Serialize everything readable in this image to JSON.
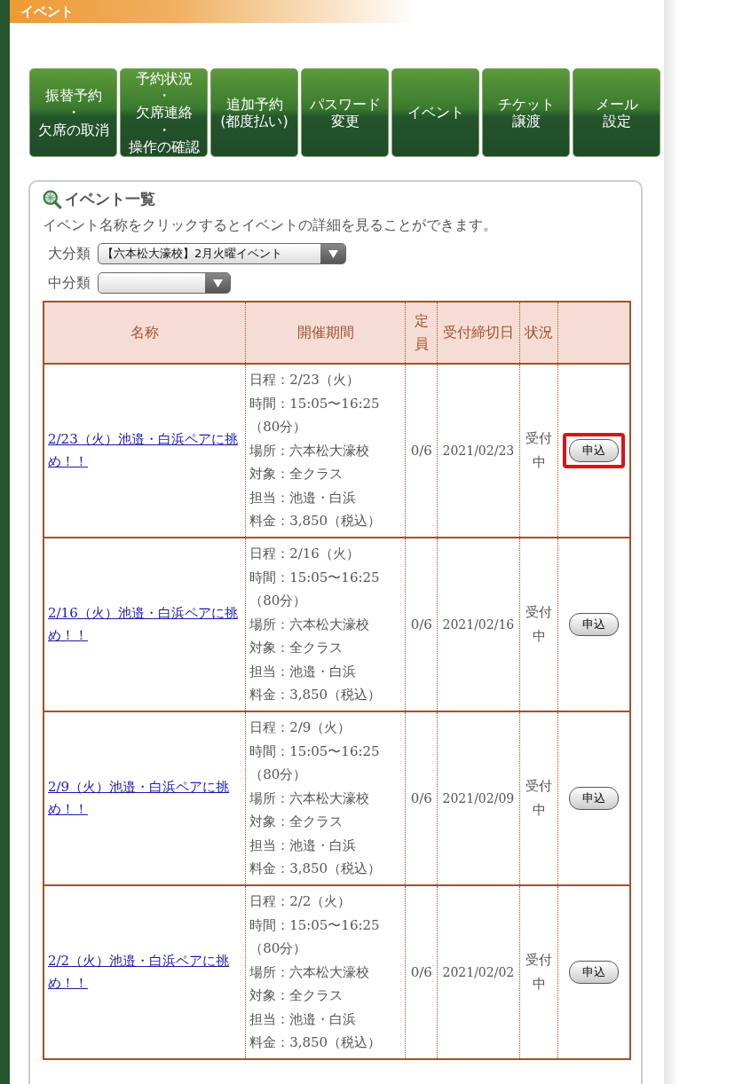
{
  "header": {
    "title": "イベント"
  },
  "nav": [
    {
      "lines": [
        "振替予約",
        "・",
        "欠席の取消"
      ]
    },
    {
      "lines": [
        "予約状況",
        "・",
        "欠席連絡",
        "・",
        "操作の確認"
      ]
    },
    {
      "lines": [
        "追加予約",
        "(都度払い)"
      ]
    },
    {
      "lines": [
        "パスワード",
        "変更"
      ]
    },
    {
      "lines": [
        "イベント"
      ]
    },
    {
      "lines": [
        "チケット",
        "譲渡"
      ]
    },
    {
      "lines": [
        "メール",
        "設定"
      ]
    }
  ],
  "panel": {
    "title": "イベント一覧",
    "note": "イベント名称をクリックするとイベントの詳細を見ることができます。",
    "filters": [
      {
        "label": "大分類",
        "value": "【六本松大濠校】2月火曜イベント"
      },
      {
        "label": "中分類"
      }
    ]
  },
  "table": {
    "columns": [
      "名称",
      "開催期間",
      "定員",
      "受付締切日",
      "状況"
    ],
    "rows": [
      {
        "name": "2/23（火）池邉・白浜ペアに挑め！！",
        "details": [
          "日程：2/23（火）",
          "時間：15:05〜16:25",
          "（80分）",
          "場所：六本松大濠校",
          "対象：全クラス",
          "担当：池邉・白浜",
          "料金：3,850（税込）"
        ],
        "capacity": "0/6",
        "deadline": "2021/02/23",
        "status": "受付中",
        "action": "申込",
        "highlighted": true
      },
      {
        "name": "2/16（火）池邉・白浜ペアに挑め！！",
        "details": [
          "日程：2/16（火）",
          "時間：15:05〜16:25",
          "（80分）",
          "場所：六本松大濠校",
          "対象：全クラス",
          "担当：池邉・白浜",
          "料金：3,850（税込）"
        ],
        "capacity": "0/6",
        "deadline": "2021/02/16",
        "status": "受付中",
        "action": "申込",
        "highlighted": false
      },
      {
        "name": "2/9（火）池邉・白浜ペアに挑め！！",
        "details": [
          "日程：2/9（火）",
          "時間：15:05〜16:25",
          "（80分）",
          "場所：六本松大濠校",
          "対象：全クラス",
          "担当：池邉・白浜",
          "料金：3,850（税込）"
        ],
        "capacity": "0/6",
        "deadline": "2021/02/09",
        "status": "受付中",
        "action": "申込",
        "highlighted": false
      },
      {
        "name": "2/2（火）池邉・白浜ペアに挑め！！",
        "details": [
          "日程：2/2（火）",
          "時間：15:05〜16:25",
          "（80分）",
          "場所：六本松大濠校",
          "対象：全クラス",
          "担当：池邉・白浜",
          "料金：3,850（税込）"
        ],
        "capacity": "0/6",
        "deadline": "2021/02/02",
        "status": "受付中",
        "action": "申込",
        "highlighted": false
      }
    ]
  }
}
